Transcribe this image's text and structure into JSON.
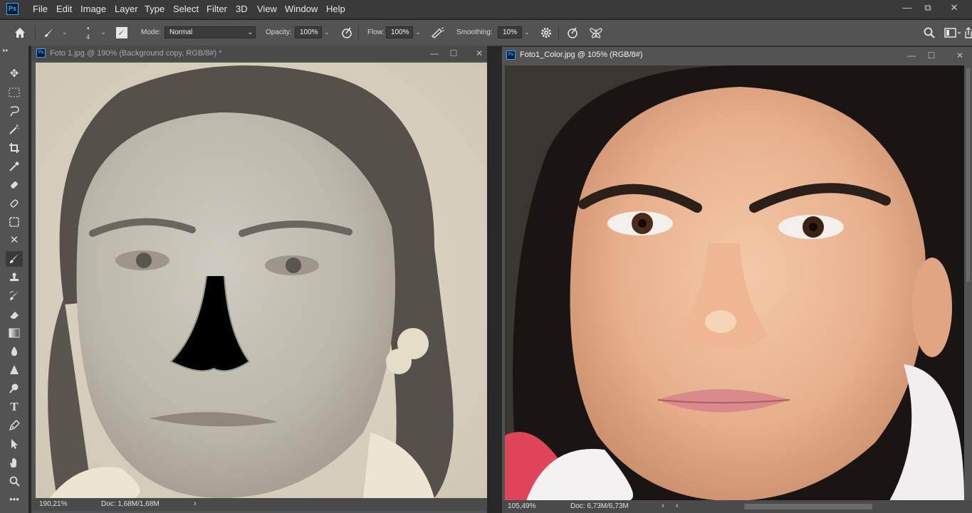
{
  "app": {
    "logo": "Ps",
    "menu": [
      "File",
      "Edit",
      "Image",
      "Layer",
      "Type",
      "Select",
      "Filter",
      "3D",
      "View",
      "Window",
      "Help"
    ],
    "window_controls": {
      "minimize": "—",
      "restore": "⧉",
      "close": "✕"
    }
  },
  "options": {
    "brush_size": "4",
    "mode_label": "Mode:",
    "mode_value": "Normal",
    "opacity_label": "Opacity:",
    "opacity_value": "100%",
    "flow_label": "Flow:",
    "flow_value": "100%",
    "smoothing_label": "Smoothing:",
    "smoothing_value": "10%"
  },
  "tools": [
    "move-tool",
    "marquee-tool",
    "lasso-tool",
    "magic-wand-tool",
    "crop-tool",
    "eyedropper-tool",
    "healing-brush-tool",
    "patch-tool",
    "frame-tool",
    "content-aware-move-tool",
    "brush-tool",
    "clone-stamp-tool",
    "history-brush-tool",
    "eraser-tool",
    "gradient-tool",
    "blur-tool",
    "sharpen-tool",
    "dodge-tool",
    "type-tool",
    "pen-tool",
    "path-selection-tool",
    "hand-tool",
    "zoom-tool",
    "more-tools"
  ],
  "doc1": {
    "title": "Foto 1.jpg @ 190% (Background copy, RGB/8#) *",
    "zoom": "190,21%",
    "doc_size": "Doc: 1,68M/1,68M"
  },
  "doc2": {
    "title": "Foto1_Color.jpg @ 105% (RGB/8#)",
    "zoom": "105,49%",
    "doc_size": "Doc: 6,73M/6,73M"
  },
  "colors": {
    "accent": "#31a8ff",
    "panel": "#535353",
    "menubar": "#3a3a3a"
  }
}
